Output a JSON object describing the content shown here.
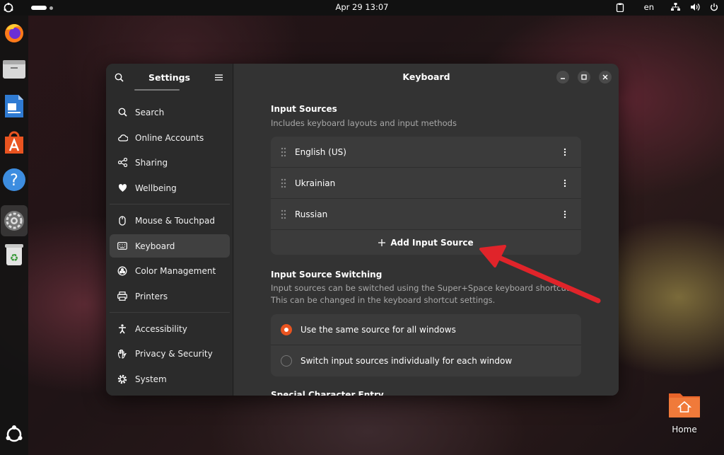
{
  "topbar": {
    "clock": "Apr 29  13:07",
    "language": "en"
  },
  "dock": {
    "items": [
      "firefox-icon",
      "files-icon",
      "writer-icon",
      "app-center-icon",
      "help-icon",
      "settings-icon",
      "trash-icon",
      "show-apps-icon"
    ]
  },
  "desktop": {
    "home_label": "Home"
  },
  "settings": {
    "sidebar_title": "Settings",
    "sidebar_items": [
      {
        "label": "Search"
      },
      {
        "label": "Online Accounts"
      },
      {
        "label": "Sharing"
      },
      {
        "label": "Wellbeing"
      },
      {
        "label": "Mouse & Touchpad"
      },
      {
        "label": "Keyboard"
      },
      {
        "label": "Color Management"
      },
      {
        "label": "Printers"
      },
      {
        "label": "Accessibility"
      },
      {
        "label": "Privacy & Security"
      },
      {
        "label": "System"
      }
    ],
    "active_item": "Keyboard",
    "page_title": "Keyboard",
    "input_sources": {
      "title": "Input Sources",
      "description": "Includes keyboard layouts and input methods",
      "sources": [
        {
          "label": "English (US)"
        },
        {
          "label": "Ukrainian"
        },
        {
          "label": "Russian"
        }
      ],
      "add_label": "Add Input Source"
    },
    "switching": {
      "title": "Input Source Switching",
      "description_line1": "Input sources can be switched using the Super+Space keyboard shortcut.",
      "description_line2": "This can be changed in the keyboard shortcut settings.",
      "options": [
        {
          "label": "Use the same source for all windows",
          "selected": true
        },
        {
          "label": "Switch input sources individually for each window",
          "selected": false
        }
      ]
    },
    "next_section_title": "Special Character Entry"
  },
  "colors": {
    "accent": "#e95420",
    "annotation_arrow": "#e0242a"
  }
}
